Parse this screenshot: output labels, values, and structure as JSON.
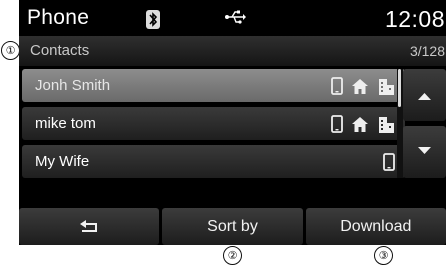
{
  "callouts": [
    "①",
    "②",
    "③"
  ],
  "status": {
    "title": "Phone",
    "bluetooth_icon": "bluetooth-icon",
    "usb_icon": "usb-icon",
    "time": "12:08"
  },
  "subheader": {
    "label": "Contacts",
    "count": "3/128"
  },
  "contacts": [
    {
      "name": "Jonh Smith",
      "icons": [
        "mobile-icon",
        "home-icon",
        "office-icon"
      ],
      "selected": true
    },
    {
      "name": "mike tom",
      "icons": [
        "mobile-icon",
        "home-icon",
        "office-icon"
      ],
      "selected": false
    },
    {
      "name": "My Wife",
      "icons": [
        "mobile-icon"
      ],
      "selected": false
    }
  ],
  "scroll": {
    "up_icon": "arrow-up-icon",
    "down_icon": "arrow-down-icon"
  },
  "bottom_bar": {
    "back_icon": "back-icon",
    "sort_label": "Sort by",
    "download_label": "Download"
  },
  "colors": {
    "background": "#000000",
    "selected_row": "#7a7a7a",
    "text": "#ffffff"
  }
}
